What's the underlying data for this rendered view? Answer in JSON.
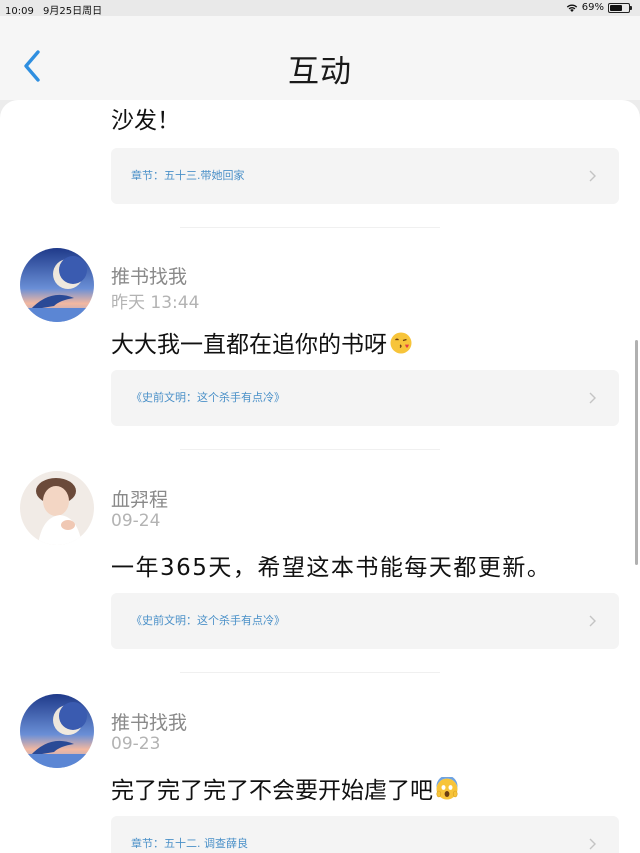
{
  "status_bar": {
    "time": "10:09",
    "date": "9月25日周日",
    "battery": "69%",
    "battery_level": 0.69
  },
  "nav": {
    "title": "互动"
  },
  "comments": [
    {
      "text": "沙发！",
      "ref": "章节：五十三.带她回家"
    },
    {
      "username": "推书找我",
      "time": "昨天 13:44",
      "text": "大大我一直都在追你的书呀",
      "emoji": "kissing-face-emoji",
      "ref": "《史前文明：这个杀手有点冷》",
      "avatar": "whale-moon-avatar"
    },
    {
      "username": "血羿程",
      "time": "09-24",
      "text": "一年365天，希望这本书能每天都更新。",
      "ref": "《史前文明：这个杀手有点冷》",
      "avatar": "person-photo-avatar"
    },
    {
      "username": "推书找我",
      "time": "09-23",
      "text": "完了完了完了不会要开始虐了吧",
      "emoji": "screaming-face-emoji",
      "ref": "章节：五十二. 调查薛良",
      "avatar": "whale-moon-avatar"
    }
  ],
  "colors": {
    "accent": "#2f8fe0",
    "ref_text": "#4a90c8",
    "ref_bg": "#f4f4f4"
  }
}
